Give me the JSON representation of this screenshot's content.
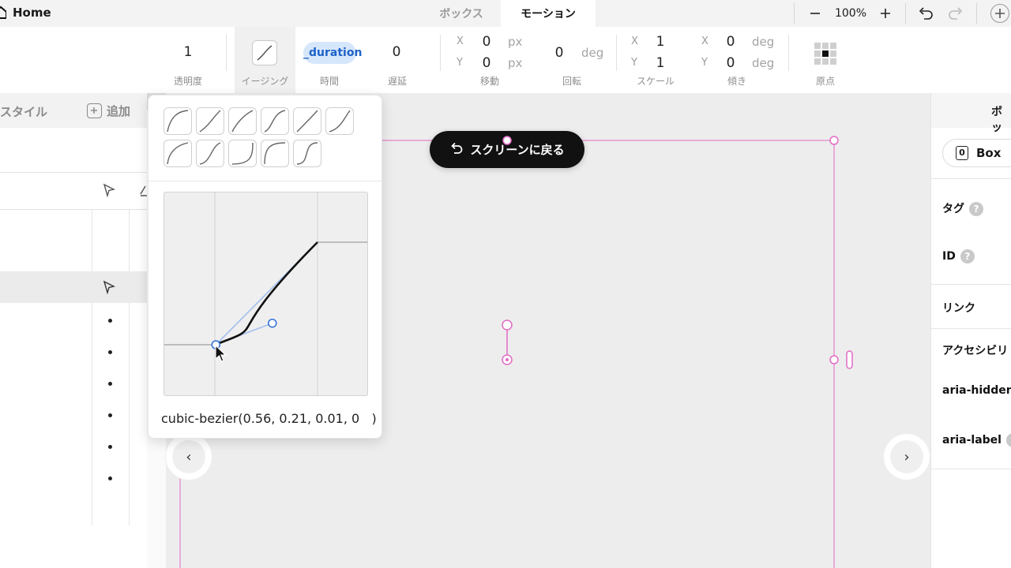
{
  "app": {
    "home_label": "Home"
  },
  "tabs": [
    {
      "label": "ボックス"
    },
    {
      "label": "モーション"
    }
  ],
  "zoom": {
    "value": "100%"
  },
  "toolbar": {
    "opacity": {
      "value": "1",
      "label": "透明度"
    },
    "easing": {
      "label": "イージング"
    },
    "duration": {
      "value": "_duration",
      "label": "時間"
    },
    "delay": {
      "value": "0",
      "label": "遅延"
    },
    "translate": {
      "x_axis": "X",
      "y_axis": "Y",
      "x": "0",
      "y": "0",
      "unit": "px",
      "label": "移動"
    },
    "rotate": {
      "value": "0",
      "unit": "deg",
      "label": "回転"
    },
    "scale": {
      "x_axis": "X",
      "y_axis": "Y",
      "x": "1",
      "y": "1",
      "label": "スケール"
    },
    "skew": {
      "x_axis": "X",
      "y_axis": "Y",
      "x": "0",
      "y": "0",
      "unit": "deg",
      "label": "傾き"
    },
    "origin": {
      "label": "原点"
    }
  },
  "left_panel": {
    "style_label": "スタイル",
    "add_label": "追加"
  },
  "easing_popover": {
    "preset_count": 11,
    "cubic_bezier_text": "cubic-bezier(0.56, 0.21, 0.01, 0   )",
    "bezier": [
      0.56,
      0.21,
      0.01,
      0
    ]
  },
  "canvas": {
    "back_button_label": "スクリーンに戻る"
  },
  "right_panel": {
    "tab_label": "ボッ",
    "element_type": {
      "badge": "0",
      "label": "Box"
    },
    "fields": [
      {
        "label": "タグ",
        "help": "?"
      },
      {
        "label": "ID",
        "help": "?"
      },
      {
        "label": "リンク"
      },
      {
        "label": "アクセシビリ"
      },
      {
        "label": "aria-hidden"
      },
      {
        "label": "aria-label",
        "help": "?"
      }
    ]
  },
  "colors": {
    "accent_pink": "#e26bc5",
    "handle_blue": "#2f6fd6",
    "duration_pill": "#d7e7fb",
    "duration_text": "#1e62c9"
  }
}
